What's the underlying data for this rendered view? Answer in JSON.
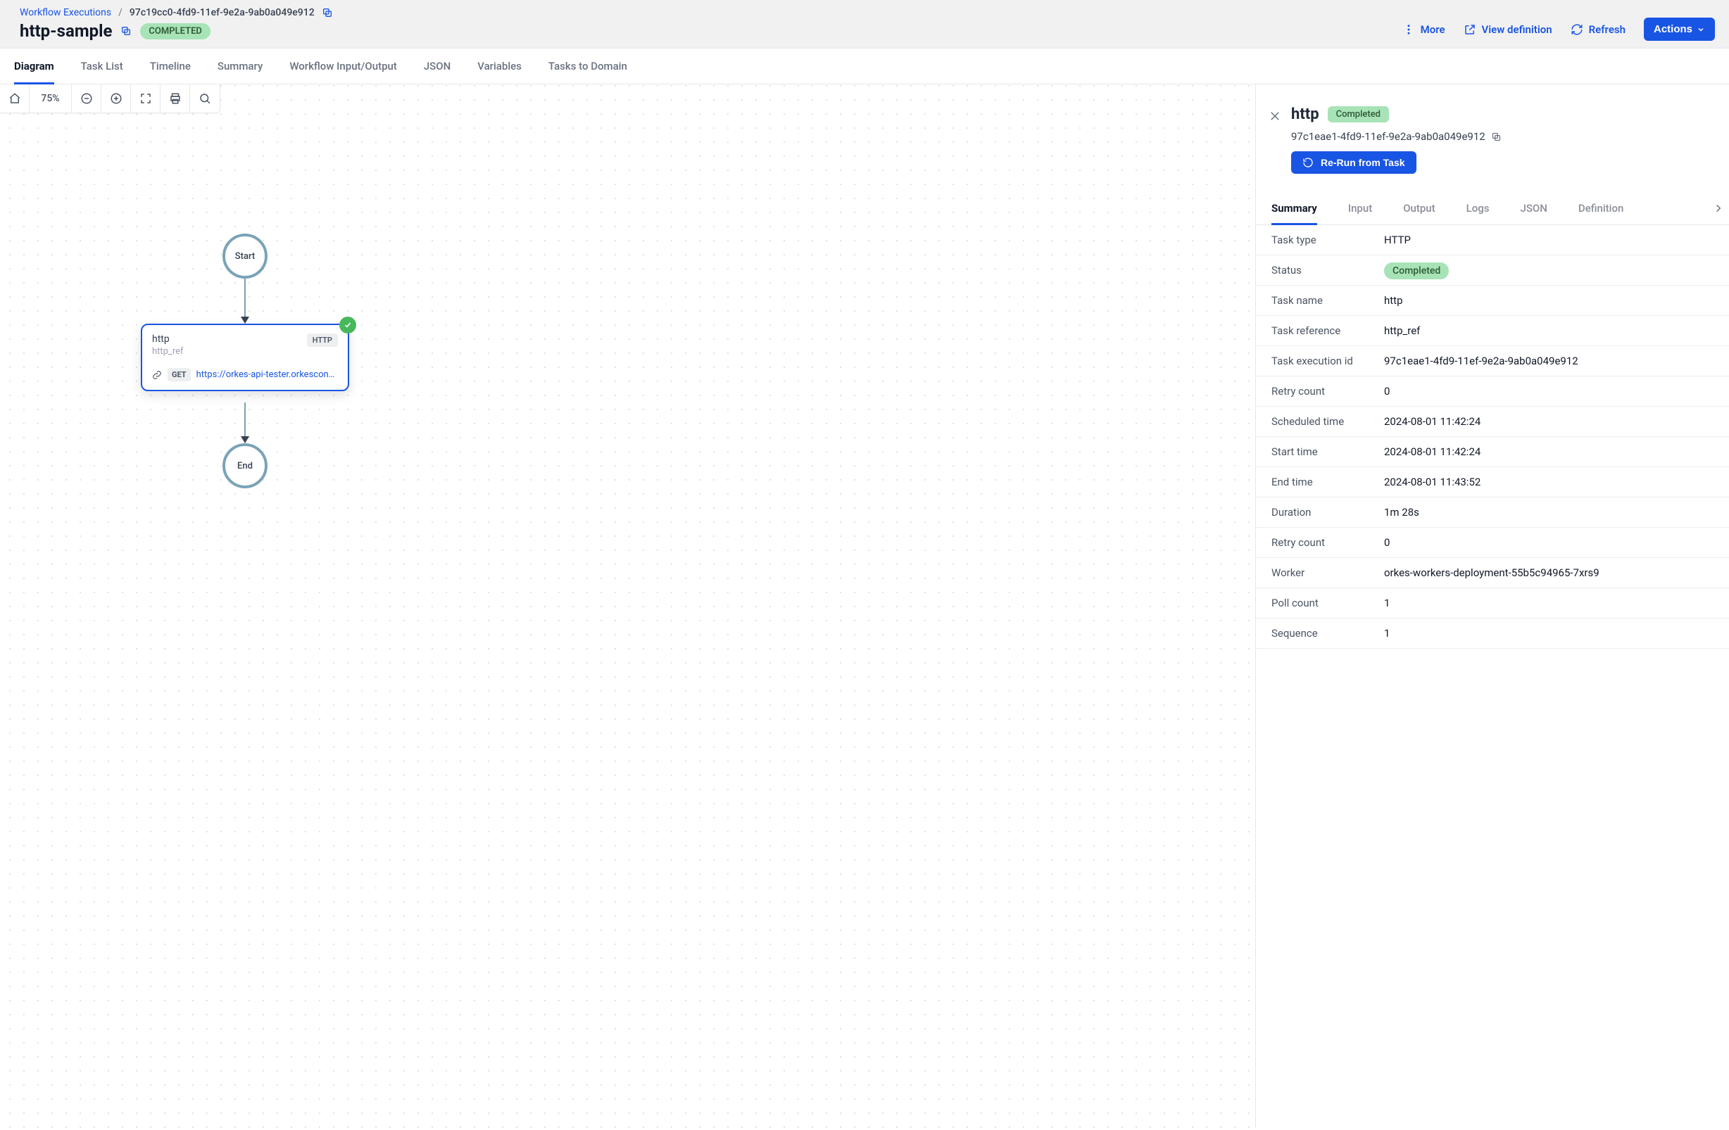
{
  "breadcrumb": {
    "root": "Workflow Executions",
    "exec_id": "97c19cc0-4fd9-11ef-9e2a-9ab0a049e912"
  },
  "page": {
    "title": "http-sample",
    "status": "COMPLETED"
  },
  "header_actions": {
    "more": "More",
    "view_definition": "View definition",
    "refresh": "Refresh",
    "actions": "Actions"
  },
  "tabs": [
    {
      "label": "Diagram",
      "active": true
    },
    {
      "label": "Task List"
    },
    {
      "label": "Timeline"
    },
    {
      "label": "Summary"
    },
    {
      "label": "Workflow Input/Output"
    },
    {
      "label": "JSON"
    },
    {
      "label": "Variables"
    },
    {
      "label": "Tasks to Domain"
    }
  ],
  "toolbar": {
    "zoom": "75%"
  },
  "diagram": {
    "start": "Start",
    "end": "End",
    "node": {
      "name": "http",
      "ref": "http_ref",
      "type": "HTTP",
      "method": "GET",
      "url": "https://orkes-api-tester.orkescondu..."
    }
  },
  "panel": {
    "title": "http",
    "status": "Completed",
    "task_id": "97c1eae1-4fd9-11ef-9e2a-9ab0a049e912",
    "rerun": "Re-Run from Task",
    "tabs": [
      {
        "label": "Summary",
        "active": true
      },
      {
        "label": "Input"
      },
      {
        "label": "Output"
      },
      {
        "label": "Logs"
      },
      {
        "label": "JSON"
      },
      {
        "label": "Definition"
      }
    ],
    "summary": [
      {
        "k": "Task type",
        "v": "HTTP"
      },
      {
        "k": "Status",
        "v": "Completed",
        "pill": true
      },
      {
        "k": "Task name",
        "v": "http"
      },
      {
        "k": "Task reference",
        "v": "http_ref"
      },
      {
        "k": "Task execution id",
        "v": "97c1eae1-4fd9-11ef-9e2a-9ab0a049e912"
      },
      {
        "k": "Retry count",
        "v": "0"
      },
      {
        "k": "Scheduled time",
        "v": "2024-08-01 11:42:24"
      },
      {
        "k": "Start time",
        "v": "2024-08-01 11:42:24"
      },
      {
        "k": "End time",
        "v": "2024-08-01 11:43:52"
      },
      {
        "k": "Duration",
        "v": "1m 28s"
      },
      {
        "k": "Retry count",
        "v": "0"
      },
      {
        "k": "Worker",
        "v": "orkes-workers-deployment-55b5c94965-7xrs9"
      },
      {
        "k": "Poll count",
        "v": "1"
      },
      {
        "k": "Sequence",
        "v": "1"
      }
    ]
  }
}
